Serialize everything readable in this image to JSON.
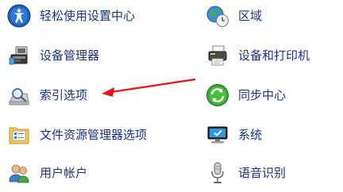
{
  "items": {
    "ease_of_access": {
      "label": "轻松使用设置中心",
      "icon": "ease-of-access-icon"
    },
    "region": {
      "label": "区域",
      "icon": "globe-clock-icon"
    },
    "device_manager": {
      "label": "设备管理器",
      "icon": "device-manager-icon"
    },
    "devices_printers": {
      "label": "设备和打印机",
      "icon": "printer-icon"
    },
    "indexing_options": {
      "label": "索引选项",
      "icon": "indexing-icon"
    },
    "sync_center": {
      "label": "同步中心",
      "icon": "sync-icon"
    },
    "file_explorer_options": {
      "label": "文件资源管理器选项",
      "icon": "folder-options-icon"
    },
    "system": {
      "label": "系统",
      "icon": "computer-monitor-icon"
    },
    "user_accounts": {
      "label": "用户帐户",
      "icon": "users-icon"
    },
    "speech_recognition": {
      "label": "语音识别",
      "icon": "microphone-icon"
    }
  },
  "annotation": {
    "color": "#e8141b",
    "target": "indexing_options"
  },
  "colors": {
    "link_text": "#1e3287",
    "background": "#ffffff"
  }
}
